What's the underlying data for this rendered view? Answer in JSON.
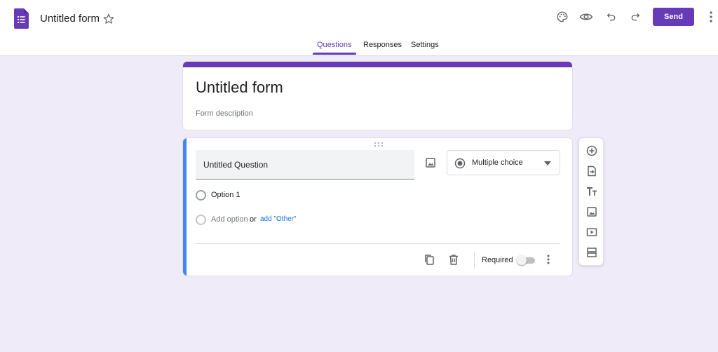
{
  "header": {
    "doc_title": "Untitled form",
    "send_label": "Send",
    "accent": "#673ab7",
    "icons": [
      "forms-logo-icon",
      "star-icon",
      "palette-icon",
      "eye-icon",
      "undo-icon",
      "redo-icon",
      "more-vert-icon"
    ]
  },
  "tabs": [
    {
      "label": "Questions",
      "active": true
    },
    {
      "label": "Responses",
      "active": false
    },
    {
      "label": "Settings",
      "active": false
    }
  ],
  "form": {
    "title": "Untitled form",
    "description_placeholder": "Form description"
  },
  "question": {
    "title": "Untitled Question",
    "type": "Multiple choice",
    "options": [
      "Option 1"
    ],
    "add_option": "Add option",
    "or": "or",
    "add_other": "add \"Other\"",
    "required_label": "Required",
    "required": false,
    "accent": "#4285f4"
  },
  "toolbar": {
    "icons": [
      "add-question-icon",
      "import-questions-icon",
      "add-title-icon",
      "add-image-icon",
      "add-video-icon",
      "add-section-icon"
    ]
  }
}
